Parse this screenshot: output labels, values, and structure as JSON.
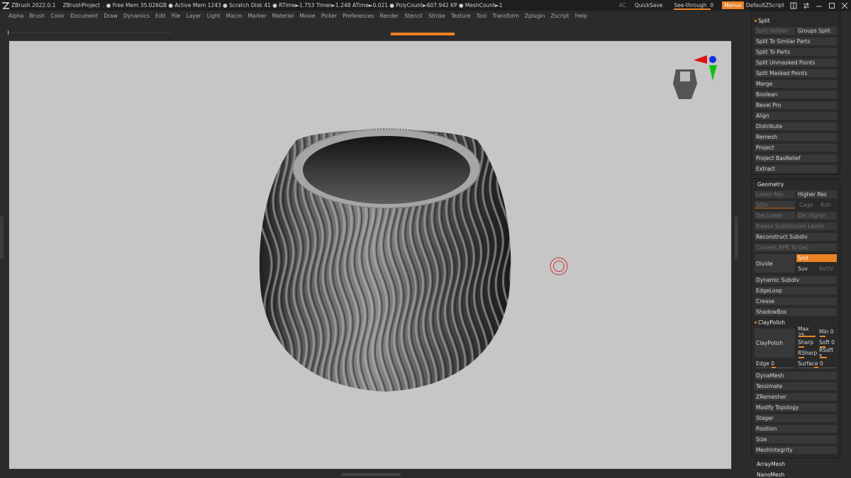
{
  "titlebar": {
    "app": "ZBrush 2022.0.1",
    "project": "ZBrushProject",
    "info": ". ● Free Mem 35.026GB ● Active Mem 1243 ● Scratch Disk 41 ●  RTime►1.753 Timer►1.248 ATime►0.021 ● PolyCount►607.942 KP  ● MeshCount►1",
    "ac": "AC",
    "quicksave": "QuickSave",
    "see_through": "See-through",
    "see_through_value": "0",
    "menus": "Menus",
    "script": "DefaultZScript"
  },
  "menubar": [
    "Alpha",
    "Brush",
    "Color",
    "Document",
    "Draw",
    "Dynamics",
    "Edit",
    "File",
    "Layer",
    "Light",
    "Macro",
    "Marker",
    "Material",
    "Movie",
    "Picker",
    "Preferences",
    "Render",
    "Stencil",
    "Stroke",
    "Texture",
    "Tool",
    "Transform",
    "Zplugin",
    "Zscript",
    "Help"
  ],
  "subtool": {
    "header": "Split",
    "split_hidden": "Split Hidden",
    "groups_split": "Groups Split",
    "items": [
      "Split To Similar Parts",
      "Split To Parts",
      "Split Unmasked Points",
      "Split Masked Points"
    ],
    "after": [
      "Merge",
      "Boolean",
      "Bevel Pro",
      "Align",
      "Distribute",
      "Remesh",
      "Project",
      "Project BasRelief",
      "Extract"
    ]
  },
  "geometry": {
    "header": "Geometry",
    "lower_res": "Lower Res",
    "higher_res": "Higher Res",
    "sdiv": "SDiv",
    "cage": "Cage",
    "rstr": "Rstr",
    "del_lower": "Del Lower",
    "del_higher": "Del Higher",
    "freeze": "Freeze SubDivision Levels",
    "reconstruct": "Reconstruct Subdiv",
    "convert_bpr": "Convert BPR To Geo",
    "divide": "Divide",
    "smt": "Smt",
    "suv": "Suv",
    "reuv": "ReUV",
    "items_a": [
      "Dynamic Subdiv",
      "EdgeLoop",
      "Crease",
      "ShadowBox"
    ],
    "claypolish_head": "ClayPolish",
    "claypolish": "ClayPolish",
    "max": "Max 25",
    "min": "Min 0",
    "sharp": "Sharp",
    "soft": "Soft 0",
    "rsharp": "RSharp",
    "rsoft": "RSoft 5",
    "edge": "Edge 0",
    "surface": "Surface 0",
    "items_b": [
      "DynaMesh",
      "Tessimate",
      "ZRemesher",
      "Modify Topology",
      "Stager",
      "Position",
      "Size",
      "MeshIntegrity"
    ]
  },
  "bottom": [
    "ArrayMesh",
    "NanoMesh"
  ],
  "colors": {
    "accent": "#ea8224",
    "viewport": "#c6c6c6",
    "panel": "#2a2a2a"
  }
}
